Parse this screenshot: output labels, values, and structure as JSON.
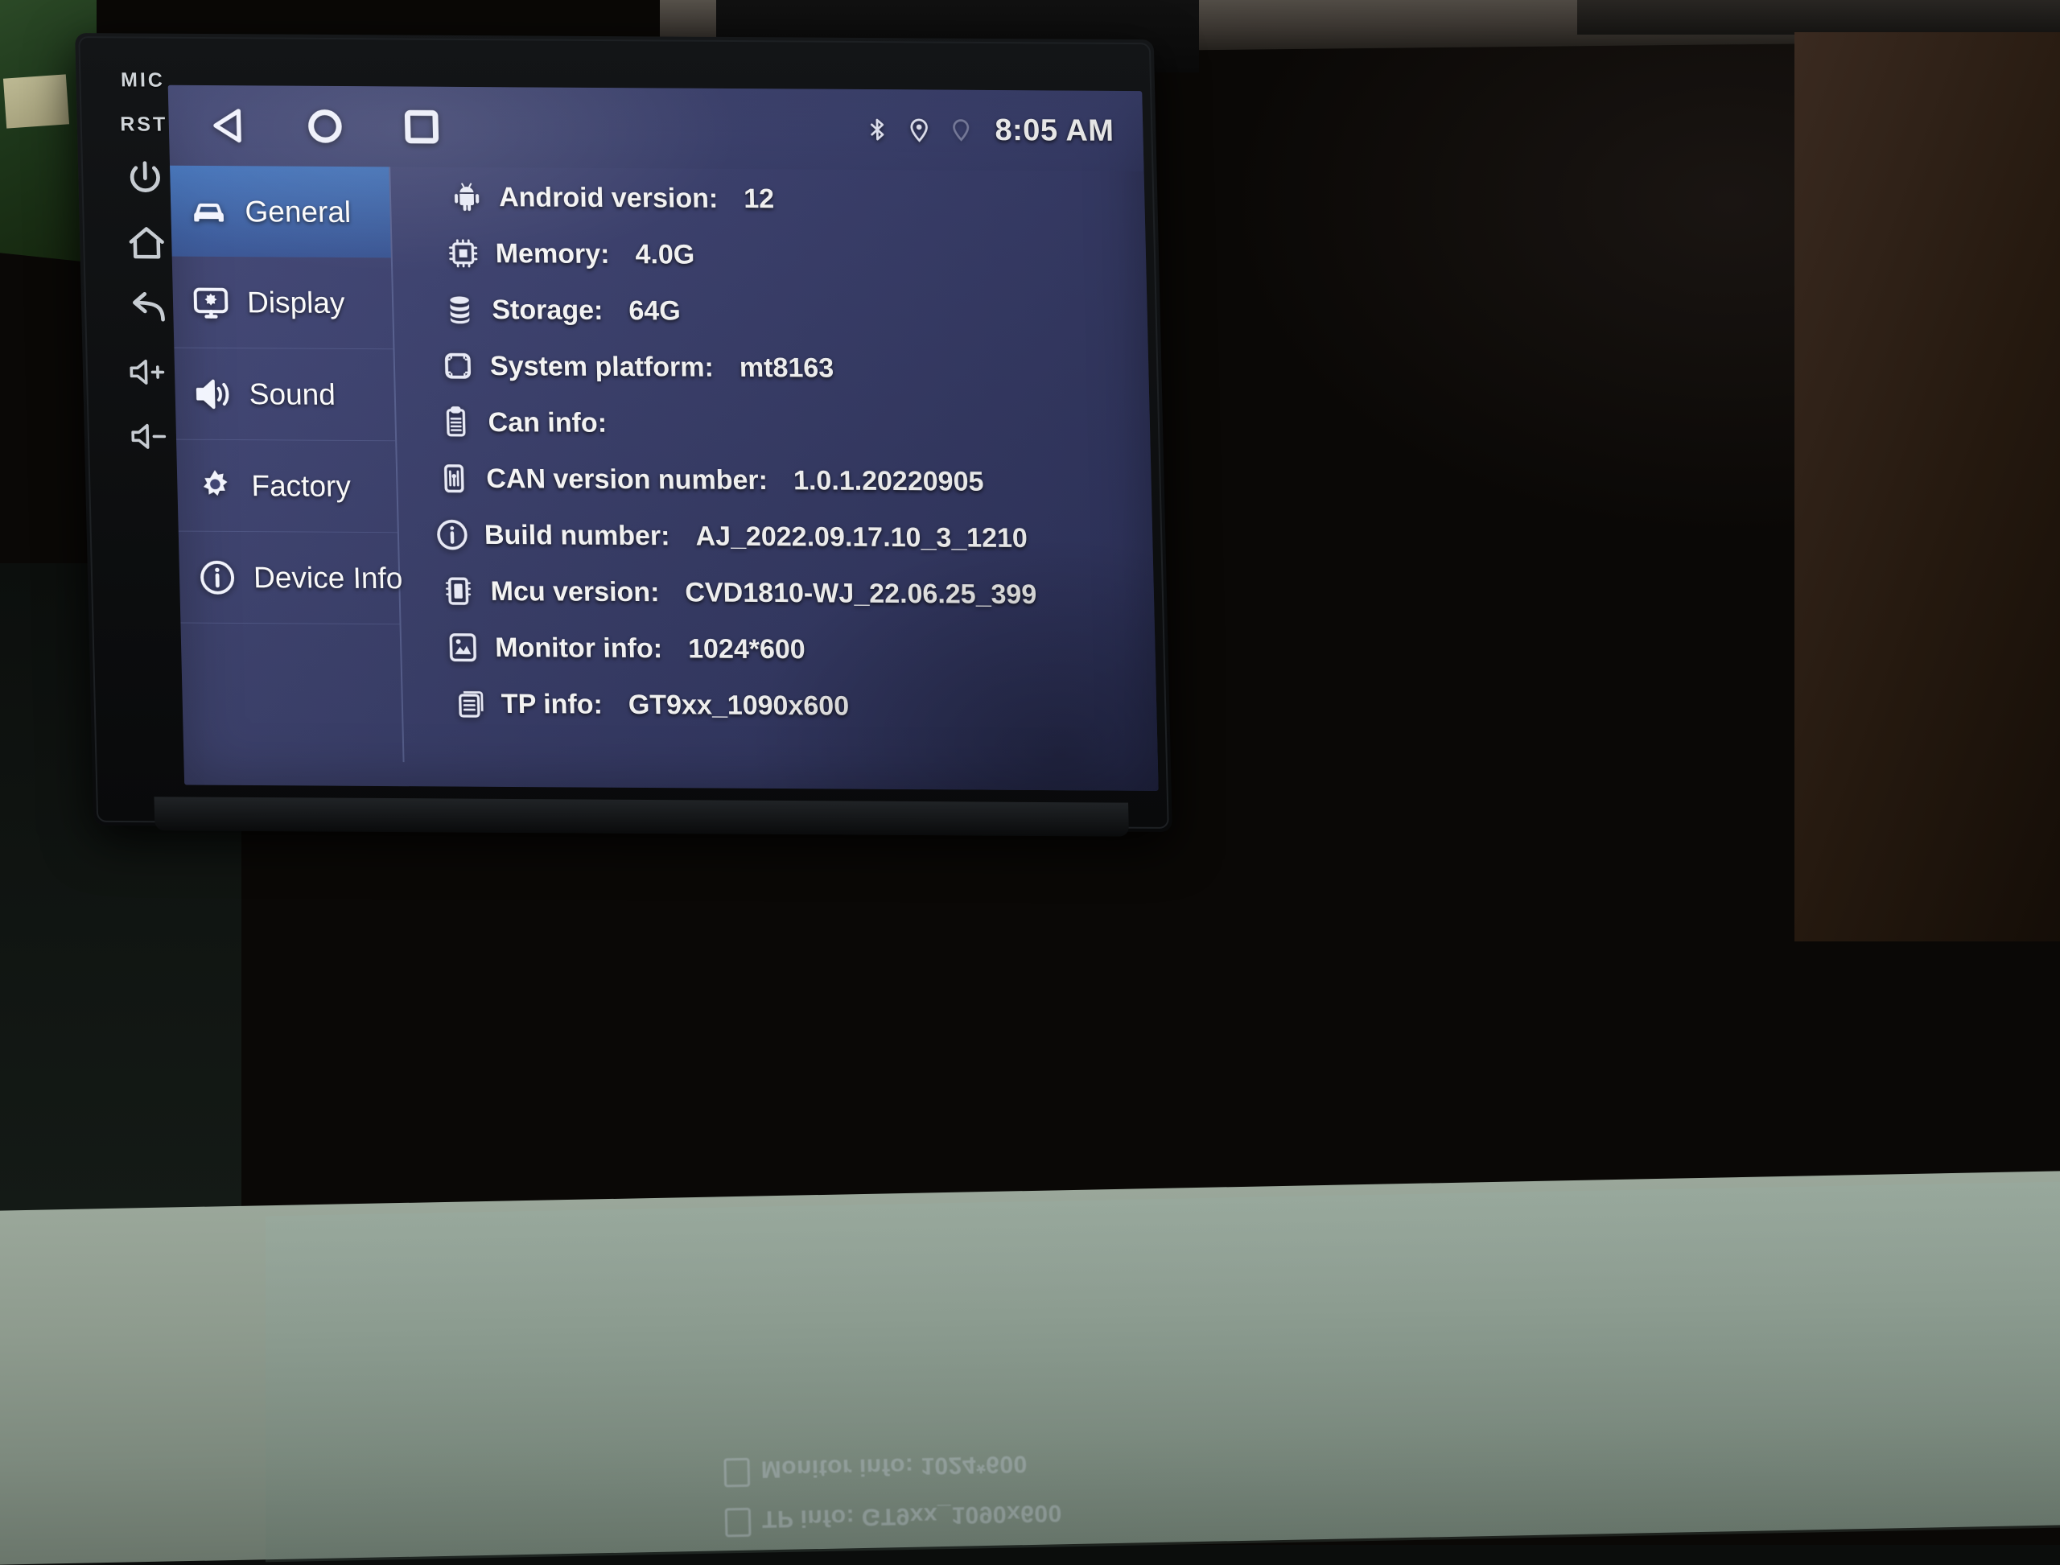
{
  "device": {
    "hardware_keys": [
      {
        "name": "mic",
        "label": "MIC",
        "type": "text"
      },
      {
        "name": "reset",
        "label": "RST",
        "type": "text"
      },
      {
        "name": "power",
        "label": "",
        "type": "icon"
      },
      {
        "name": "home",
        "label": "",
        "type": "icon"
      },
      {
        "name": "back",
        "label": "",
        "type": "icon"
      },
      {
        "name": "volume-up",
        "label": "",
        "type": "icon"
      },
      {
        "name": "volume-down",
        "label": "",
        "type": "icon"
      }
    ]
  },
  "statusbar": {
    "nav": [
      {
        "name": "back-nav",
        "icon": "triangle-left-icon"
      },
      {
        "name": "home-nav",
        "icon": "circle-icon"
      },
      {
        "name": "recents-nav",
        "icon": "square-icon"
      }
    ],
    "icons": [
      {
        "name": "bluetooth",
        "icon": "bluetooth-icon",
        "state": "on"
      },
      {
        "name": "location",
        "icon": "location-pin-icon",
        "state": "on"
      },
      {
        "name": "gps-idle",
        "icon": "location-pin-outline-icon",
        "state": "dim"
      }
    ],
    "clock": "8:05 AM"
  },
  "sidebar": {
    "items": [
      {
        "label": "General",
        "icon": "car-icon",
        "active": true
      },
      {
        "label": "Display",
        "icon": "monitor-gear-icon",
        "active": false
      },
      {
        "label": "Sound",
        "icon": "speaker-icon",
        "active": false
      },
      {
        "label": "Factory",
        "icon": "gear-icon",
        "active": false
      },
      {
        "label": "Device Info",
        "icon": "info-circle-icon",
        "active": false
      }
    ]
  },
  "details": {
    "rows": [
      {
        "icon": "android-icon",
        "label": "Android version:",
        "value": "12"
      },
      {
        "icon": "memory-chip-icon",
        "label": "Memory:",
        "value": "4.0G"
      },
      {
        "icon": "database-icon",
        "label": "Storage:",
        "value": "64G"
      },
      {
        "icon": "chip-square-icon",
        "label": "System platform:",
        "value": "mt8163"
      },
      {
        "icon": "clipboard-icon",
        "label": "Can info:",
        "value": ""
      },
      {
        "icon": "can-module-icon",
        "label": "CAN version number:",
        "value": "1.0.1.20220905"
      },
      {
        "icon": "info-circle-icon",
        "label": "Build number:",
        "value": "AJ_2022.09.17.10_3_1210"
      },
      {
        "icon": "mcu-chip-icon",
        "label": "Mcu version:",
        "value": "CVD1810-WJ_22.06.25_399"
      },
      {
        "icon": "monitor-image-icon",
        "label": "Monitor info:",
        "value": "1024*600"
      },
      {
        "icon": "touch-panel-icon",
        "label": "TP info:",
        "value": "GT9xx_1090x600"
      }
    ]
  },
  "reflection": {
    "line1": "TP info:  GT9xx_1090x600",
    "line2": "Monitor info:  1024*600"
  },
  "colors": {
    "screen_bg": "#3a3f6e",
    "active_nav": "#3c78c8",
    "text": "#ffffff",
    "bezel": "#0e1012"
  }
}
